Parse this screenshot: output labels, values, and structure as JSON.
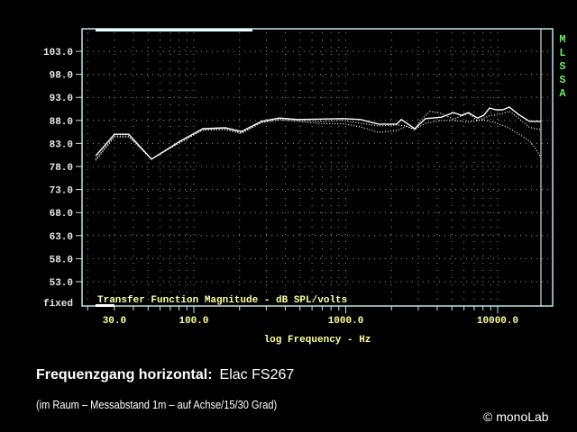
{
  "chart_data": {
    "type": "line",
    "title": "Transfer Function Magnitude - dB SPL/volts",
    "xlabel": "log Frequency - Hz",
    "xscale": "log",
    "xlim": [
      22,
      19500
    ],
    "ylim": [
      48,
      108
    ],
    "y_ticks": [
      103,
      98,
      93,
      88,
      83,
      78,
      73,
      68,
      63,
      58,
      53
    ],
    "y_tick_labels": [
      "103.0",
      "98.0",
      "93.0",
      "88.0",
      "83.0",
      "78.0",
      "73.0",
      "68.0",
      "63.0",
      "58.0",
      "53.0"
    ],
    "y_bottom_label": "fixed",
    "x_tick_labels": [
      {
        "f": 30,
        "label": "30.0"
      },
      {
        "f": 100,
        "label": "100.0"
      },
      {
        "f": 1000,
        "label": "1000.0"
      },
      {
        "f": 10000,
        "label": "10000.0"
      }
    ],
    "side_label": [
      "M",
      "L",
      "S",
      "S",
      "A"
    ],
    "grid": true,
    "series": [
      {
        "name": "0° (on axis)",
        "style": "solid",
        "x": [
          22.6,
          30,
          37.3,
          52.6,
          81.4,
          114.6,
          161,
          206,
          279,
          366,
          482,
          700,
          952,
          1252,
          1647,
          2166,
          2320,
          2850,
          3350,
          4270,
          5120,
          5780,
          6420,
          7360,
          8100,
          8840,
          9760,
          10800,
          11950,
          13700,
          16200,
          19200
        ],
        "y": [
          80.3,
          85.0,
          85.0,
          79.6,
          83.5,
          86.2,
          86.4,
          85.6,
          87.8,
          88.5,
          88.2,
          88.3,
          88.4,
          88.2,
          87.2,
          87.2,
          88.2,
          86.2,
          88.4,
          88.7,
          89.7,
          89.1,
          89.7,
          88.5,
          89.1,
          90.7,
          90.3,
          90.3,
          90.9,
          89.3,
          87.8,
          87.8
        ]
      },
      {
        "name": "15°",
        "style": "dotted",
        "x": [
          22.6,
          30,
          37.3,
          52.6,
          81.4,
          114.6,
          161,
          206,
          279,
          366,
          482,
          700,
          952,
          1252,
          1647,
          2166,
          2500,
          2850,
          3100,
          3600,
          4270,
          5120,
          6420,
          7360,
          8840,
          10800,
          11950,
          13700,
          16200,
          19200
        ],
        "y": [
          79.6,
          84.6,
          84.6,
          79.6,
          83.3,
          86.0,
          86.2,
          85.3,
          87.6,
          88.3,
          88.0,
          87.8,
          88.0,
          87.4,
          86.8,
          87.0,
          86.8,
          86.0,
          88.0,
          90.0,
          89.5,
          88.3,
          89.5,
          88.0,
          89.0,
          89.5,
          90.0,
          88.5,
          86.5,
          86.0
        ]
      },
      {
        "name": "30°",
        "style": "dotted",
        "x": [
          22.6,
          30,
          37.3,
          52.6,
          81.4,
          114.6,
          161,
          206,
          279,
          366,
          482,
          700,
          952,
          1252,
          1647,
          2166,
          2500,
          2850,
          3350,
          4270,
          5120,
          6420,
          8100,
          9760,
          11950,
          14800,
          16200,
          17800,
          19200
        ],
        "y": [
          79.3,
          84.4,
          84.4,
          79.6,
          83.2,
          85.9,
          86.0,
          85.2,
          87.5,
          88.1,
          87.8,
          87.3,
          87.3,
          86.6,
          85.4,
          85.8,
          86.7,
          86.0,
          87.4,
          88.0,
          88.0,
          87.7,
          88.1,
          87.5,
          86.3,
          84.4,
          83.5,
          81.9,
          80.0
        ]
      }
    ]
  },
  "caption": {
    "title_bold": "Frequenzgang horizontal:",
    "model": "Elac FS267",
    "subtitle": "(im Raum – Messabstand 1m – auf Achse/15/30 Grad)",
    "copyright": "© monoLab"
  },
  "colors": {
    "frame": "#b8e8e8",
    "grid": "#9a9a9a",
    "curve": "#ffffff",
    "xlabel": "#ffff99",
    "side": "#66ee66"
  }
}
